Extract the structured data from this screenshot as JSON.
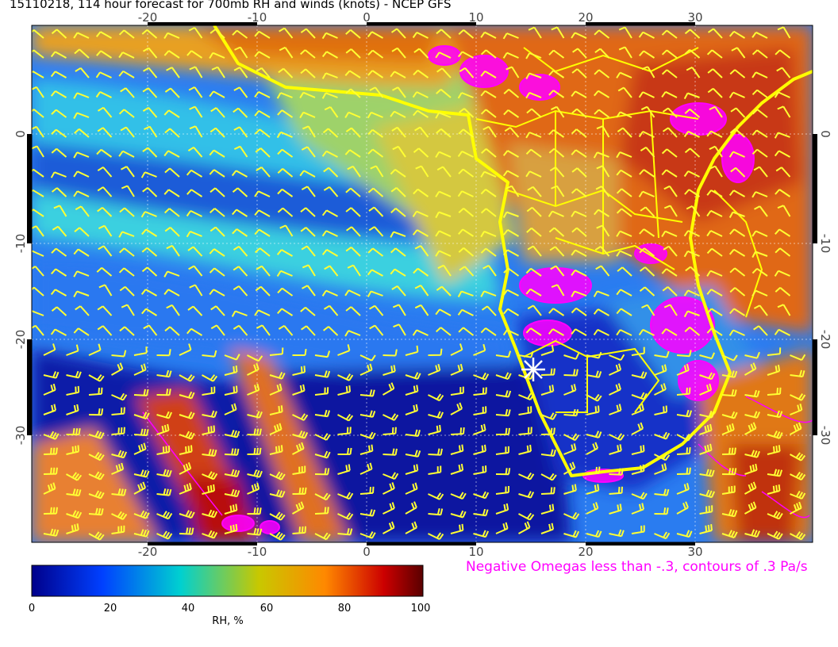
{
  "title": "15110218, 114 hour forecast for 700mb RH and winds (knots) - NCEP GFS",
  "map": {
    "lon_range": [
      -30,
      40
    ],
    "lat_range": [
      -40,
      10
    ],
    "top_lon_ticks": [
      "-20",
      "-10",
      "0",
      "10",
      "20",
      "30"
    ],
    "bottom_lon_ticks": [
      "-20",
      "-10",
      "0",
      "10",
      "20",
      "30"
    ],
    "left_lat_ticks": [
      "0",
      "-10",
      "-20",
      "-30"
    ],
    "right_lat_ticks": [
      "0",
      "-10",
      "-20",
      "-30"
    ],
    "marker": {
      "type": "star",
      "lon": 15,
      "lat": -23.5,
      "color": "#ffffff"
    },
    "wind_barb_color": "#ffff33",
    "coastline_color": "#ffff00",
    "omega_color": "#ff00ff"
  },
  "omega_note": "Negative Omegas less than -.3, contours of .3 Pa/s",
  "colorbar": {
    "label": "RH, %",
    "ticks": [
      "0",
      "20",
      "40",
      "60",
      "80",
      "100"
    ],
    "stops": [
      "#00008b",
      "#0050ff",
      "#00d0d0",
      "#c8c800",
      "#ff8800",
      "#cc0000",
      "#5a0000"
    ]
  }
}
